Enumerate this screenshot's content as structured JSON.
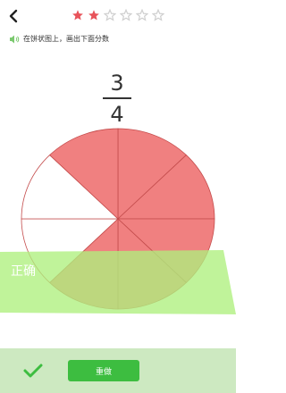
{
  "header": {
    "back_icon": "chevron-left-icon",
    "progress_stars": [
      {
        "state": "filled",
        "color": "#e8535a"
      },
      {
        "state": "filled",
        "color": "#e8535a"
      },
      {
        "state": "empty",
        "color": "#cfcfcf"
      },
      {
        "state": "empty",
        "color": "#cfcfcf"
      },
      {
        "state": "empty",
        "color": "#cfcfcf"
      },
      {
        "state": "empty",
        "color": "#cfcfcf"
      }
    ]
  },
  "instruction": {
    "icon": "speaker-icon",
    "text": "在饼状图上，画出下面分数"
  },
  "fraction": {
    "numerator": "3",
    "denominator": "4"
  },
  "pie": {
    "slices_total": 8,
    "slices_shaded": 6,
    "shaded_color": "#f08080",
    "empty_color": "#ffffff",
    "line_color": "#c44c4c"
  },
  "result": {
    "text": "正确",
    "color": "#aef07e"
  },
  "footer": {
    "check_icon": "checkmark-icon",
    "redo_label": "重做",
    "accent": "#3dbd40"
  }
}
